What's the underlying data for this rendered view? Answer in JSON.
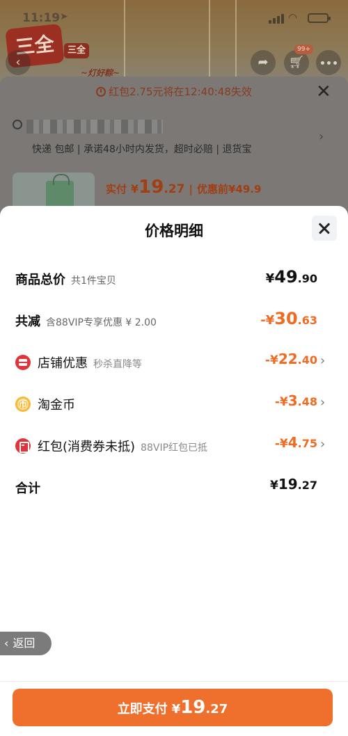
{
  "status_bar": {
    "time": "11:19",
    "location_arrow": "➤"
  },
  "background_page": {
    "brand_logo": "三全",
    "brand_badge": "三全",
    "brand_slogan": "~灯好粽~",
    "cart_count": "99+",
    "countdown_banner": "红包2.75元将在12:40:48失效",
    "shipping_info": "快递 包邮 | 承诺48小时内发货，超时必赔 | 退货宝",
    "pay_label": "实付",
    "pay_currency": "¥",
    "pay_int": "19",
    "pay_dec": ".27",
    "pre_discount": "优惠前",
    "pre_discount_price": "¥49.9"
  },
  "sheet": {
    "title": "价格明细",
    "rows": [
      {
        "label": "商品总价",
        "sub": "共1件宝贝",
        "amount_sign": "¥",
        "amount_int": "49",
        "amount_dec": ".90"
      },
      {
        "label": "共减",
        "sub": "含88VIP专享优惠 ¥ 2.00",
        "amount_sign": "-¥",
        "amount_int": "30",
        "amount_dec": ".63"
      },
      {
        "label": "店铺优惠",
        "sub": "秒杀直降等",
        "icon": "store-icon",
        "amount_sign": "-¥",
        "amount_int": "22",
        "amount_dec": ".40"
      },
      {
        "label": "淘金币",
        "sub": "",
        "icon": "coin-icon",
        "icon_glyph": "币",
        "amount_sign": "-¥",
        "amount_int": "3",
        "amount_dec": ".48"
      },
      {
        "label": "红包(消费券未抵)",
        "sub": "88VIP红包已抵",
        "icon": "red-packet-icon",
        "amount_sign": "-¥",
        "amount_int": "4",
        "amount_dec": ".75"
      },
      {
        "label": "合计",
        "sub": "",
        "amount_sign": "¥",
        "amount_int": "19",
        "amount_dec": ".27"
      }
    ]
  },
  "back_button": {
    "label": "返回"
  },
  "pay_button": {
    "label": "立即支付",
    "sign": "¥",
    "int": "19",
    "dec": ".27"
  },
  "colors": {
    "accent_orange": "#f16a21",
    "pay_button": "#ef6f2d",
    "icon_red": "#e0343a",
    "icon_gold": "#f5b93b"
  }
}
